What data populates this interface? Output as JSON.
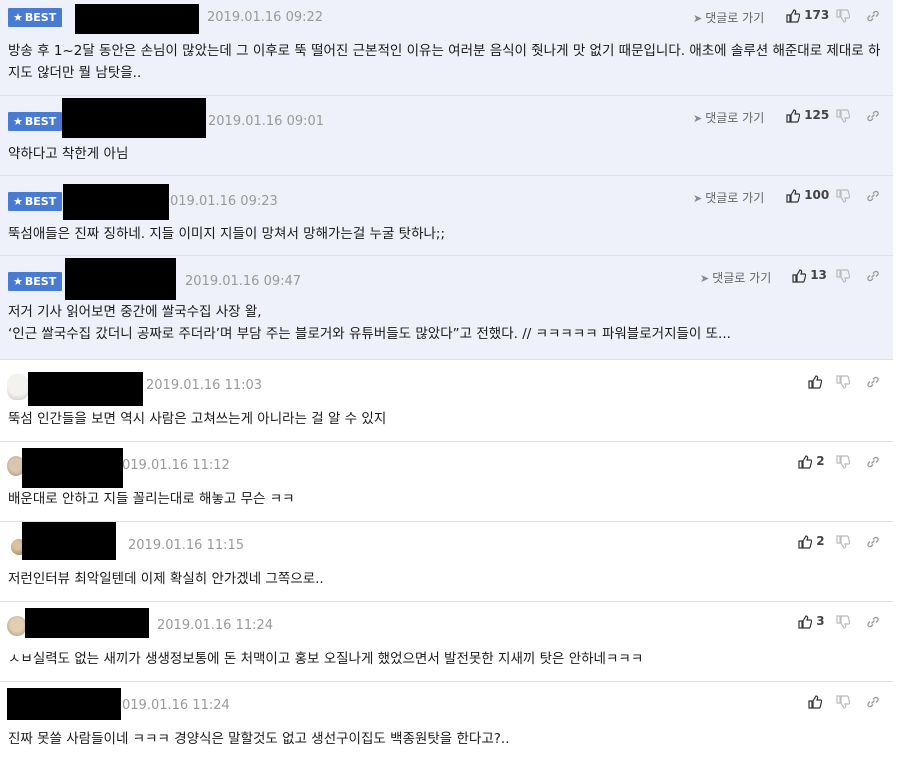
{
  "comments": [
    {
      "best": true,
      "date": "2019.01.16 09:22",
      "reply_label": "댓글로 가기",
      "likes": "173",
      "badge": "BEST",
      "text": "방송 후 1~2달 동안은 손님이 많았는데 그 이후로 뚝 떨어진 근본적인 이유는 여러분 음식이 줫나게 맛 없기 때문입니다. 애초에 솔루션 해준대로 제대로 하지도 않더만 뭘 남탓을.."
    },
    {
      "best": true,
      "date": "2019.01.16 09:01",
      "reply_label": "댓글로 가기",
      "likes": "125",
      "badge": "BEST",
      "text": "약하다고 착한게 아님"
    },
    {
      "best": true,
      "date": "019.01.16 09:23",
      "reply_label": "댓글로 가기",
      "likes": "100",
      "badge": "BEST",
      "text": "뚝섬애들은 진짜 징하네. 지들 이미지 지들이 망쳐서 망해가는걸 누굴 탓하나;;"
    },
    {
      "best": true,
      "date": "2019.01.16 09:47",
      "reply_label": "댓글로 가기",
      "likes": "13",
      "badge": "BEST",
      "text": "저거 기사 읽어보면 중간에 쌀국수집 사장 왈,\n‘인근 쌀국수집 갔더니 공짜로 주더라’며 부담 주는 블로거와 유튜버들도 많았다”고 전했다. // ㅋㅋㅋㅋㅋ 파워블로거지들이 또..."
    },
    {
      "best": false,
      "date": "2019.01.16 11:03",
      "likes": "",
      "text": "뚝섬 인간들을 보면 역시 사람은 고쳐쓰는게 아니라는 걸 알 수 있지"
    },
    {
      "best": false,
      "date": "019.01.16 11:12",
      "likes": "2",
      "text": "배운대로 안하고 지들 꼴리는대로 해놓고 무슨 ㅋㅋ"
    },
    {
      "best": false,
      "date": "2019.01.16 11:15",
      "likes": "2",
      "text": "저런인터뷰 최악일텐데 이제 확실히 안가겠네 그쪽으로.."
    },
    {
      "best": false,
      "date": "2019.01.16 11:24",
      "likes": "3",
      "text": "ㅅㅂ실력도 없는 새끼가 생생정보통에 돈 처맥이고 홍보 오질나게 했었으면서 발전못한 지새끼 탓은 안하네ㅋㅋㅋ"
    },
    {
      "best": false,
      "date": "019.01.16 11:24",
      "likes": "",
      "text": "진짜 못쓸 사람들이네 ㅋㅋㅋ 경양식은 말할것도 없고 생선구이집도 백종원탓을 한다고?.."
    }
  ],
  "colors": {
    "best_bg": "#eef0fa",
    "badge": "#4a7bd3",
    "date": "#9a9a9a"
  }
}
